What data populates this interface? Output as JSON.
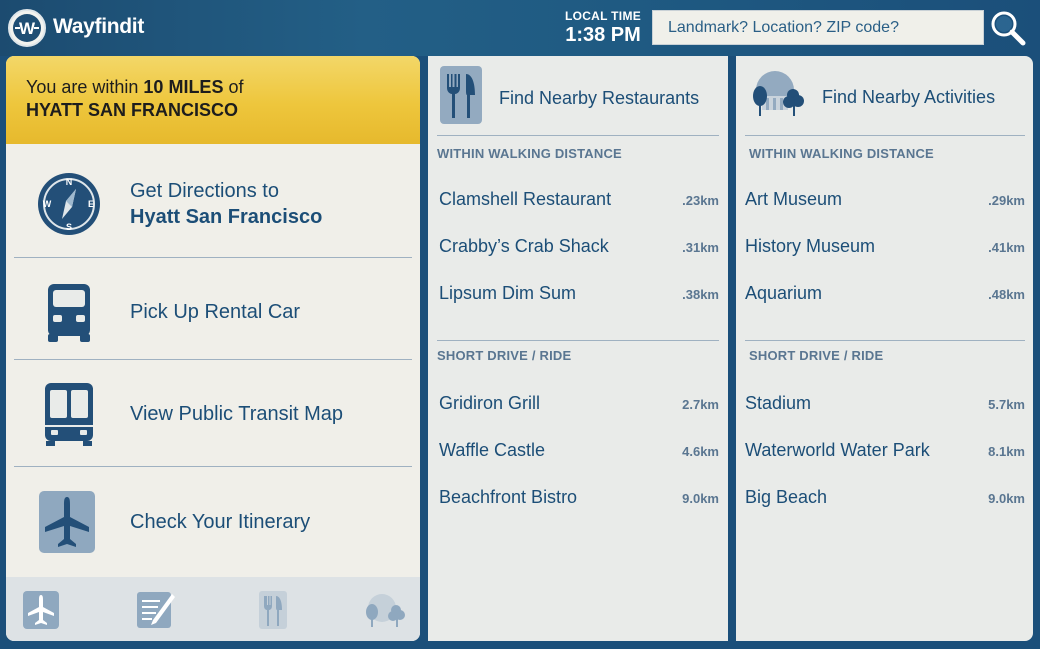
{
  "app": {
    "name": "Wayfindit"
  },
  "header": {
    "time_label": "LOCAL TIME",
    "time_value": "1:38 PM",
    "search_placeholder": "Landmark? Location? ZIP code?"
  },
  "banner": {
    "prefix": "You are within ",
    "distance": "10 MILES",
    "suffix": " of",
    "place": "HYATT SAN FRANCISCO"
  },
  "menu": {
    "directions_line1": "Get Directions to",
    "directions_line2": "Hyatt San Francisco",
    "rental": "Pick Up Rental Car",
    "transit": "View Public Transit Map",
    "itinerary": "Check Your Itinerary"
  },
  "restaurants": {
    "title": "Find Nearby Restaurants",
    "walking_title": "WITHIN WALKING DISTANCE",
    "walking": [
      {
        "name": "Clamshell Restaurant",
        "dist": ".23km"
      },
      {
        "name": "Crabby’s Crab Shack",
        "dist": ".31km"
      },
      {
        "name": "Lipsum Dim Sum",
        "dist": ".38km"
      }
    ],
    "drive_title": "SHORT DRIVE / RIDE",
    "drive": [
      {
        "name": "Gridiron Grill",
        "dist": "2.7km"
      },
      {
        "name": "Waffle Castle",
        "dist": "4.6km"
      },
      {
        "name": "Beachfront Bistro",
        "dist": "9.0km"
      }
    ]
  },
  "activities": {
    "title": "Find Nearby Activities",
    "walking_title": "WITHIN WALKING DISTANCE",
    "walking": [
      {
        "name": "Art Museum",
        "dist": ".29km"
      },
      {
        "name": "History Museum",
        "dist": ".41km"
      },
      {
        "name": "Aquarium",
        "dist": ".48km"
      }
    ],
    "drive_title": "SHORT DRIVE / RIDE",
    "drive": [
      {
        "name": "Stadium",
        "dist": "5.7km"
      },
      {
        "name": "Waterworld Water Park",
        "dist": "8.1km"
      },
      {
        "name": "Big Beach",
        "dist": "9.0km"
      }
    ]
  },
  "icons": {
    "logo": "wayfindit-logo-icon",
    "search": "magnifier-icon",
    "directions": "compass-icon",
    "rental": "car-icon",
    "transit": "train-icon",
    "itinerary": "airplane-icon",
    "restaurants": "fork-knife-icon",
    "activities": "museum-trees-icon",
    "tab_itinerary": "airplane-icon",
    "tab_notes": "notepad-icon",
    "tab_restaurants": "fork-knife-icon",
    "tab_activities": "museum-trees-icon"
  },
  "colors": {
    "brand_blue": "#1b4f7a",
    "text_blue": "#1c4e77",
    "banner_yellow": "#eec63c",
    "icon_blue": "#234f78"
  }
}
